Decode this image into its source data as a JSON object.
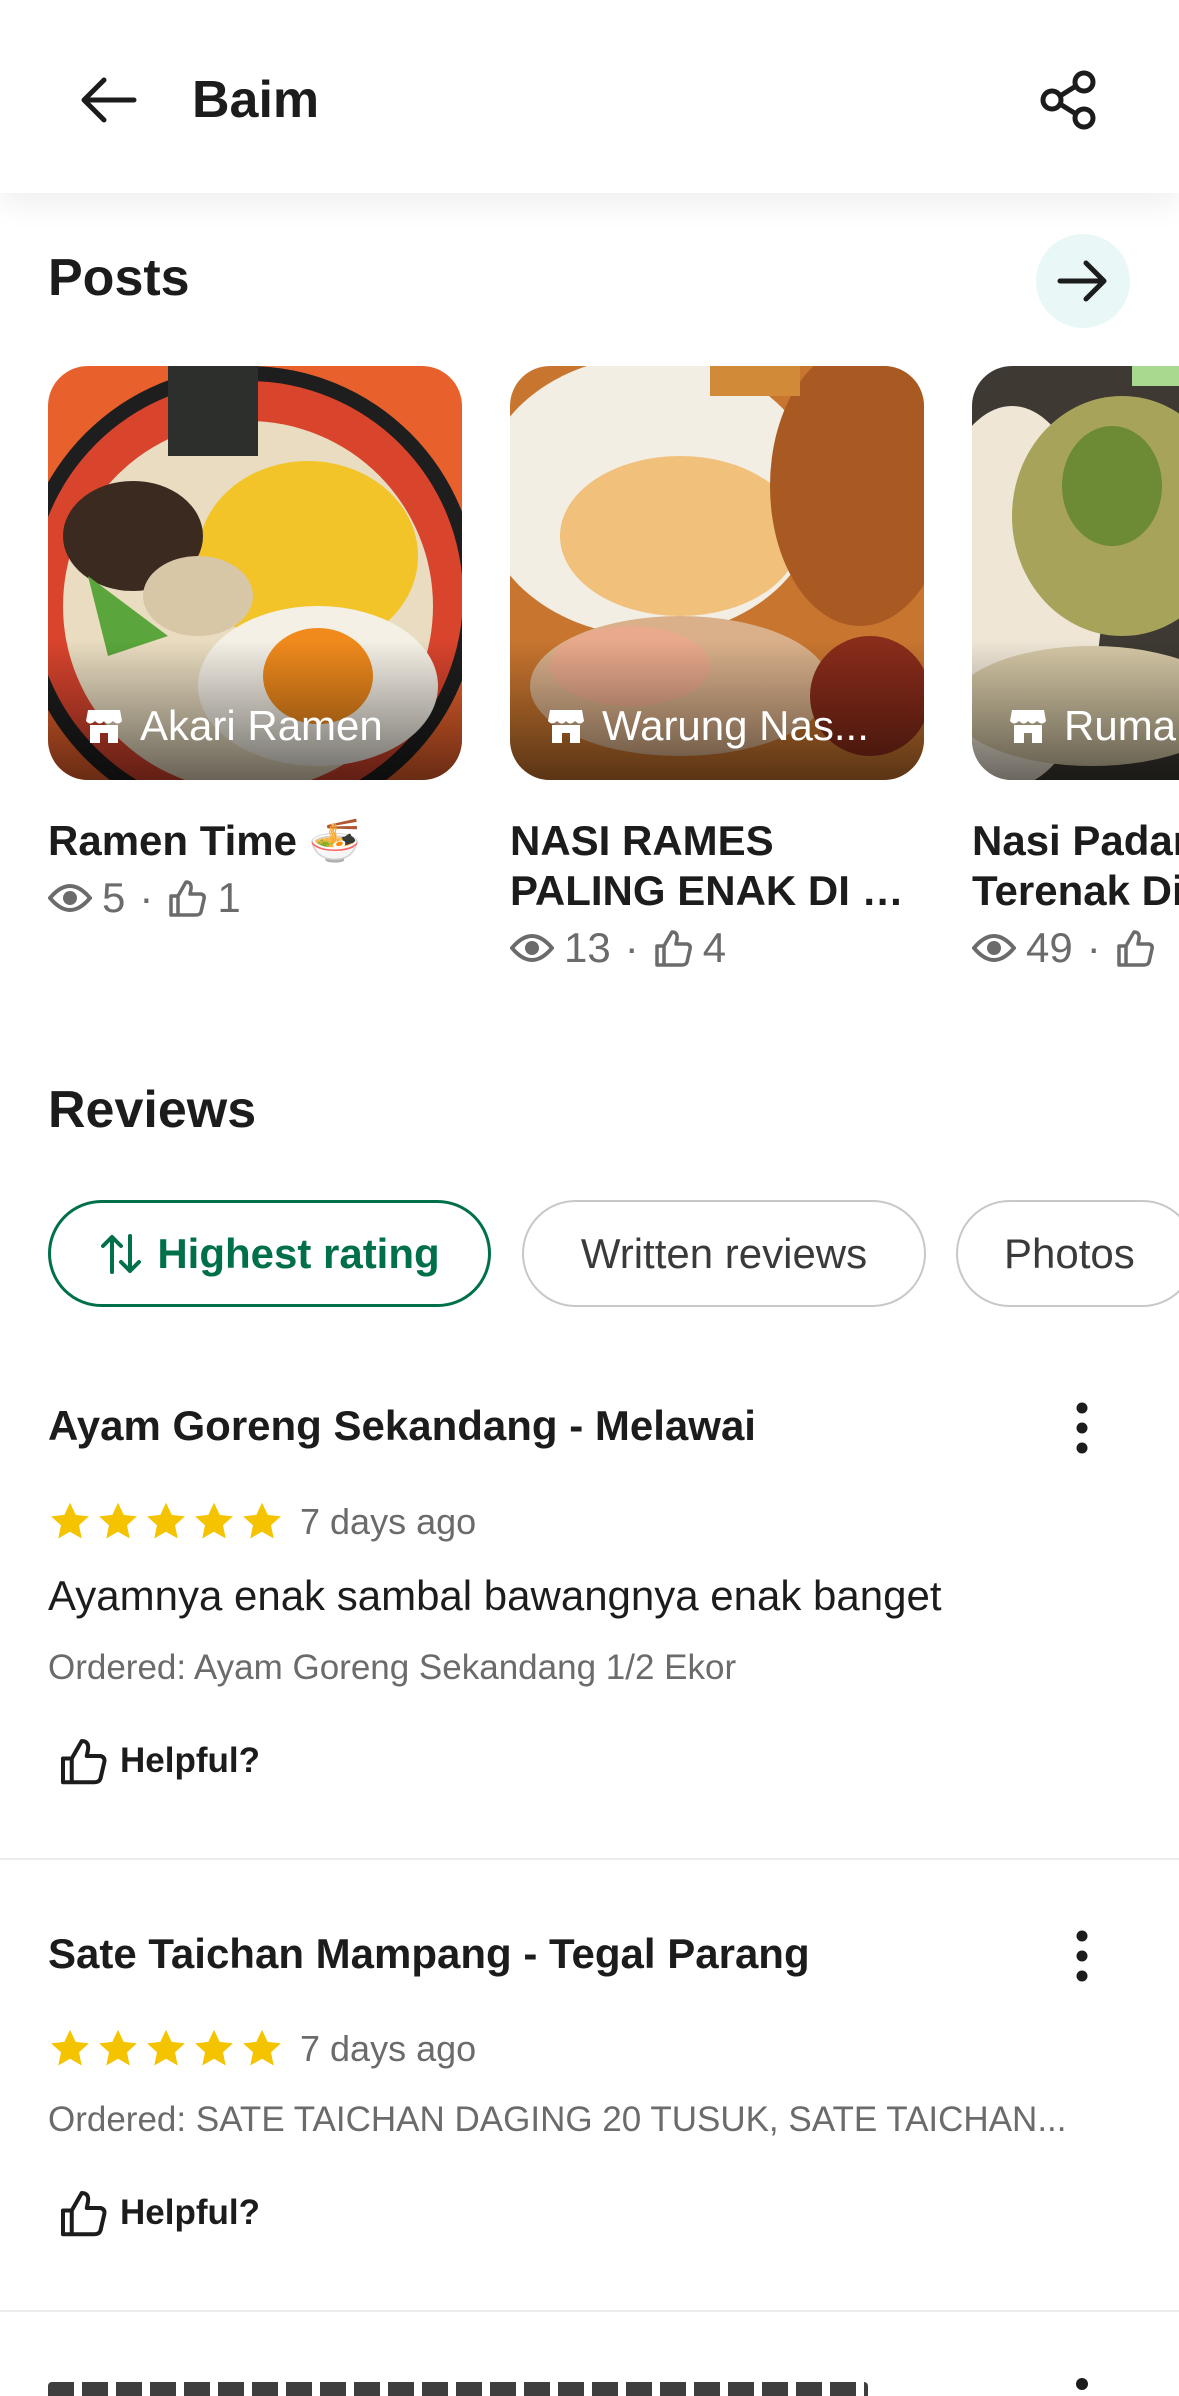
{
  "header": {
    "title": "Baim"
  },
  "posts": {
    "title": "Posts",
    "items": [
      {
        "tag": "Akari Ramen",
        "title_lines": [
          "Ramen Time 🍜"
        ],
        "views": "5",
        "likes": "1"
      },
      {
        "tag": "Warung Nas...",
        "title_lines": [
          "NASI RAMES",
          "PALING ENAK DI C..."
        ],
        "views": "13",
        "likes": "4"
      },
      {
        "tag": "Ruma",
        "title_lines": [
          "Nasi Padar",
          "Terenak Di"
        ],
        "views": "49",
        "likes": ""
      }
    ]
  },
  "reviews": {
    "title": "Reviews",
    "chips": [
      "Highest rating",
      "Written reviews",
      "Photos"
    ],
    "items": [
      {
        "restaurant": "Ayam Goreng Sekandang - Melawai",
        "rating": 5,
        "time": "7 days ago",
        "text": "Ayamnya enak sambal bawangnya enak banget",
        "ordered": "Ordered: Ayam Goreng Sekandang 1/2 Ekor",
        "helpful": "Helpful?"
      },
      {
        "restaurant": "Sate Taichan Mampang - Tegal Parang",
        "rating": 5,
        "time": "7 days ago",
        "ordered": "Ordered: SATE TAICHAN DAGING 20 TUSUK, SATE TAICHAN...",
        "helpful": "Helpful?"
      }
    ]
  },
  "colors": {
    "accent": "#00704a",
    "star": "#f5c400",
    "arrow_bg": "#e9f7f6"
  },
  "icons": [
    "back-arrow-icon",
    "share-icon",
    "arrow-right-icon",
    "store-icon",
    "eye-icon",
    "thumbs-up-icon",
    "sort-icon",
    "star-icon",
    "kebab-icon"
  ]
}
